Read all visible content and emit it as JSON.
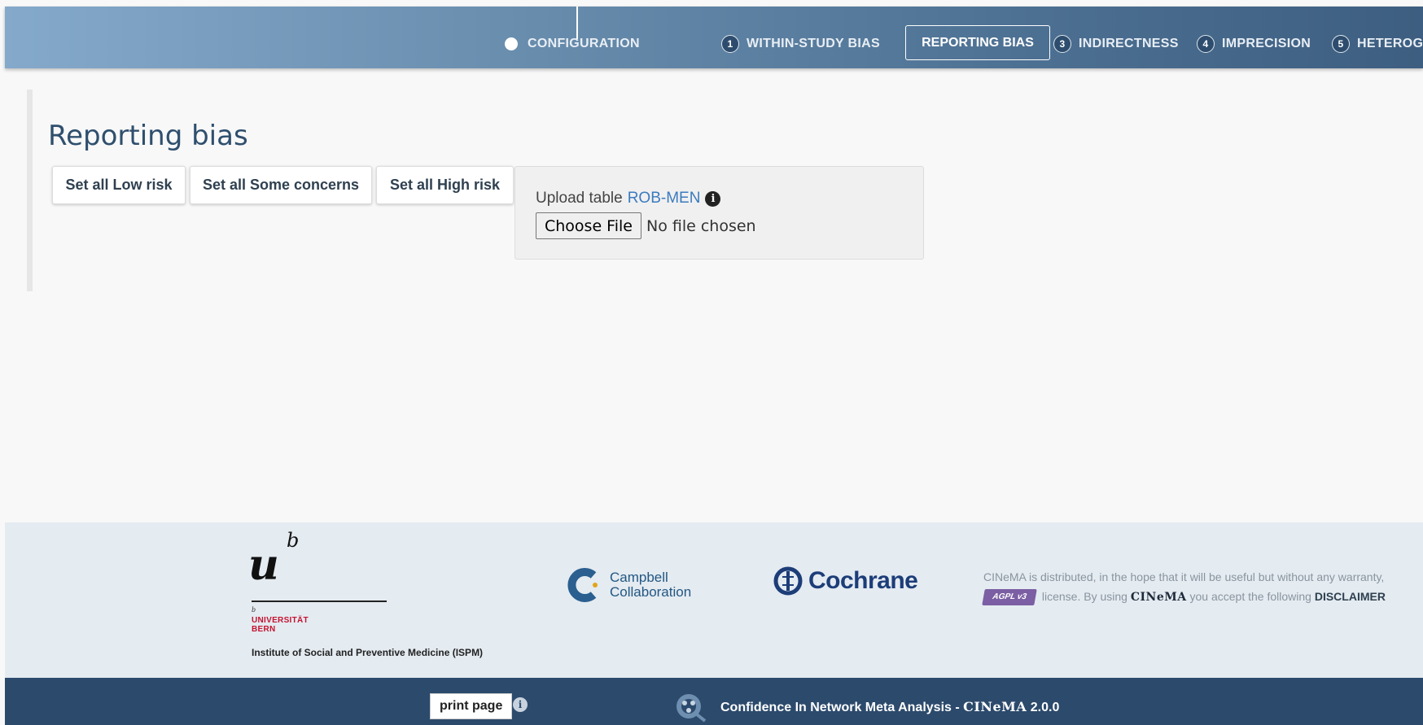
{
  "nav": {
    "configuration": "CONFIGURATION",
    "within_study_bias": {
      "num": "1",
      "label": "WITHIN-STUDY BIAS"
    },
    "reporting_bias": "REPORTING BIAS",
    "indirectness": {
      "num": "3",
      "label": "INDIRECTNESS"
    },
    "imprecision": {
      "num": "4",
      "label": "IMPRECISION"
    },
    "heterogeneity": {
      "num": "5",
      "label": "HETEROG"
    }
  },
  "main": {
    "title": "Reporting bias",
    "buttons": {
      "low": "Set all Low risk",
      "some": "Set all Some concerns",
      "high": "Set all High risk"
    },
    "upload": {
      "label": "Upload table",
      "link": "ROB-MEN",
      "info_icon": "i",
      "choose_file": "Choose File",
      "status": "No file chosen"
    }
  },
  "footer": {
    "ub": {
      "u": "u",
      "b": "b",
      "small_b": "b",
      "line1": "UNIVERSITÄT",
      "line2": "BERN"
    },
    "ispm": "Institute of Social and Preventive Medicine (ISPM)",
    "campbell": {
      "line1": "Campbell",
      "line2": "Collaboration"
    },
    "cochrane": "Cochrane",
    "disclaimer": {
      "line1": "CINeMA is distributed, in the hope that it will be useful but without any warranty,",
      "gpl": "AGPL v3",
      "license_text": "license. By using",
      "brand": "CINeMA",
      "accept_text": "you accept the following",
      "link": "DISCLAIMER"
    }
  },
  "bottom": {
    "print_label": "print page",
    "info_icon": "i",
    "title_prefix": "Confidence In Network Meta Analysis -",
    "brand": "CINeMA",
    "version": "2.0.0"
  },
  "colors": {
    "nav_dark": "#3d5e80",
    "nav_light": "#84a9cb",
    "title": "#2f4f6e",
    "link": "#3a7bbf",
    "footer_bg": "#e4ebf1",
    "bottom_bg": "#2c4a6c",
    "unibern_red": "#c4122f"
  }
}
